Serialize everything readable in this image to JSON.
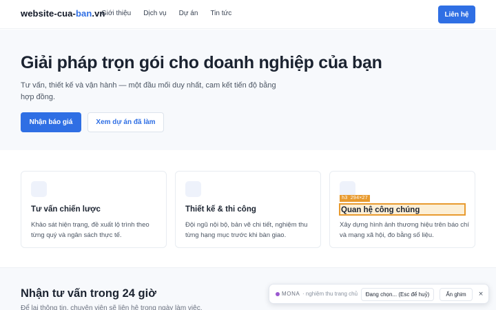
{
  "header": {
    "logo_prefix": "website-cua-",
    "logo_accent": "ban",
    "logo_suffix": ".vn",
    "nav": [
      "Giới thiệu",
      "Dịch vụ",
      "Dự án",
      "Tin tức"
    ],
    "contact_label": "Liên hệ"
  },
  "hero": {
    "title": "Giải pháp trọn gói cho doanh nghiệp của bạn",
    "subtitle": "Tư vấn, thiết kế và vận hành — một đầu mối duy nhất, cam kết tiến độ bằng hợp đồng.",
    "primary_cta": "Nhận báo giá",
    "secondary_cta": "Xem dự án đã làm"
  },
  "cards": [
    {
      "title": "Tư vấn chiến lược",
      "description": "Khảo sát hiện trạng, đề xuất lộ trình theo từng quý và ngân sách thực tế."
    },
    {
      "title": "Thiết kế & thi công",
      "description": "Đội ngũ nội bộ, bản vẽ chi tiết, nghiệm thu từng hạng mục trước khi bàn giao."
    },
    {
      "title": "Quan hệ công chúng",
      "description": "Xây dựng hình ảnh thương hiệu trên báo chí và mạng xã hội, đo bằng số liệu."
    }
  ],
  "inspector": {
    "tag": "h3 294×27"
  },
  "consult": {
    "title": "Nhận tư vấn trong 24 giờ",
    "subtitle": "Để lại thông tin, chuyên viên sẽ liên hệ trong ngày làm việc."
  },
  "toolbar": {
    "brand": "MONA",
    "mode": "· nghiệm thu trang chủ",
    "pick_label": "Đang chọn... (Esc để huỷ)",
    "hide_label": "Ẩn ghim",
    "close_glyph": "×"
  },
  "colors": {
    "accent": "#2f6fe4",
    "highlight": "#e89a2e",
    "brand_dot": "#9b59d0"
  }
}
